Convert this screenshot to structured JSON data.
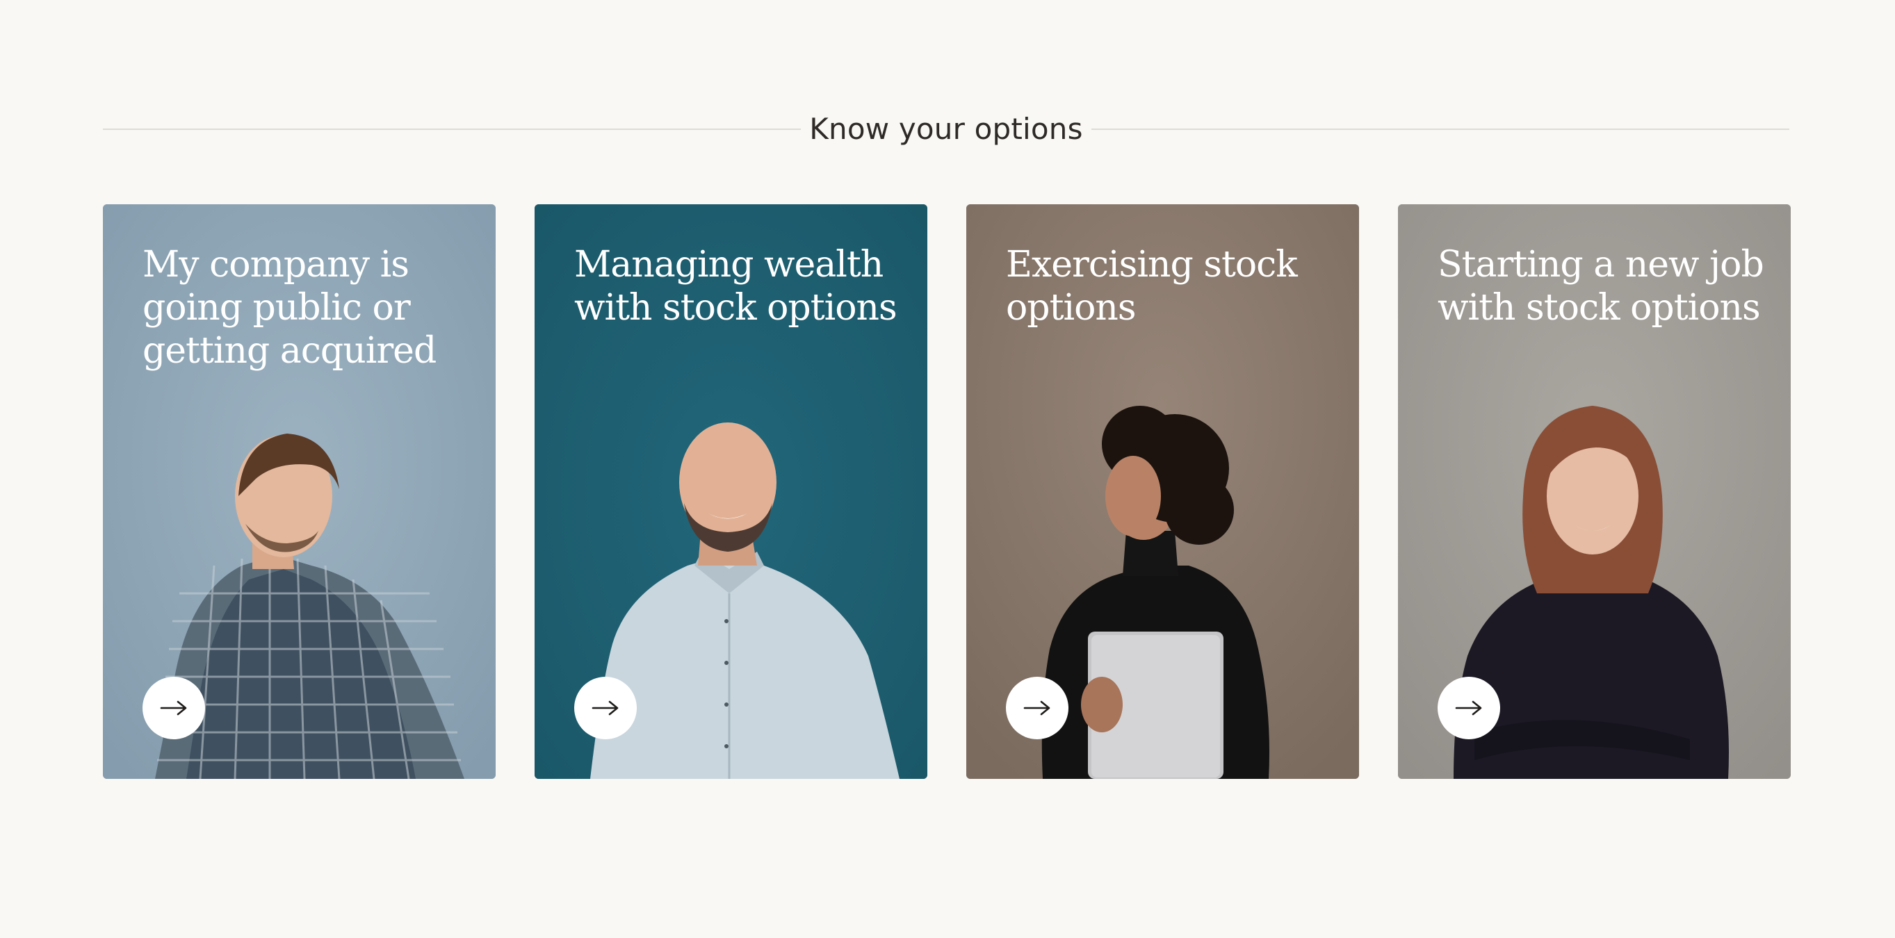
{
  "section": {
    "title": "Know your options"
  },
  "cards": [
    {
      "title": "My company is going public or getting acquired",
      "background": "#8aa0b0",
      "button_icon": "arrow-right-icon"
    },
    {
      "title": "Managing wealth with stock options",
      "background": "#1d5e6d",
      "button_icon": "arrow-right-icon"
    },
    {
      "title": "Exercising stock options",
      "background": "#857568",
      "button_icon": "arrow-right-icon"
    },
    {
      "title": "Starting a new job with stock options",
      "background": "#9c9893",
      "button_icon": "arrow-right-icon"
    }
  ]
}
